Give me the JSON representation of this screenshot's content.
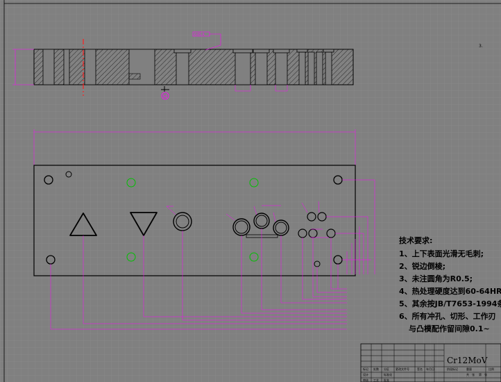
{
  "drawing": {
    "section_marker": "H",
    "material": "Cr12MoV",
    "tolerance_box": "0.05 A",
    "corner_mark": "3."
  },
  "notes": {
    "title": "技术要求:",
    "items": [
      "1、上下表面光滑无毛刺;",
      "2、锐边倒棱;",
      "3、未注圆角为R0.5;",
      "4、热处理硬度达到60-64HR",
      "5、其余按JB/T7653-1994条",
      "6、所有冲孔、切形、工作刃",
      "与凸模配作留间隙0.1~"
    ]
  },
  "title_block": {
    "cells": [
      "标记",
      "处数",
      "分区",
      "更改文件号",
      "签名",
      "年月日",
      "设计",
      "标准化",
      "阶段标记",
      "重量",
      "比例",
      "审核",
      "工艺",
      "批准",
      "共",
      "张",
      "第",
      "张"
    ]
  },
  "colors": {
    "background": "#808080",
    "grid": "#8e8e8e",
    "outline": "#000000",
    "dimension": "#ff00ff",
    "center_line": "#ff0000",
    "guide_hole": "#00c000"
  }
}
